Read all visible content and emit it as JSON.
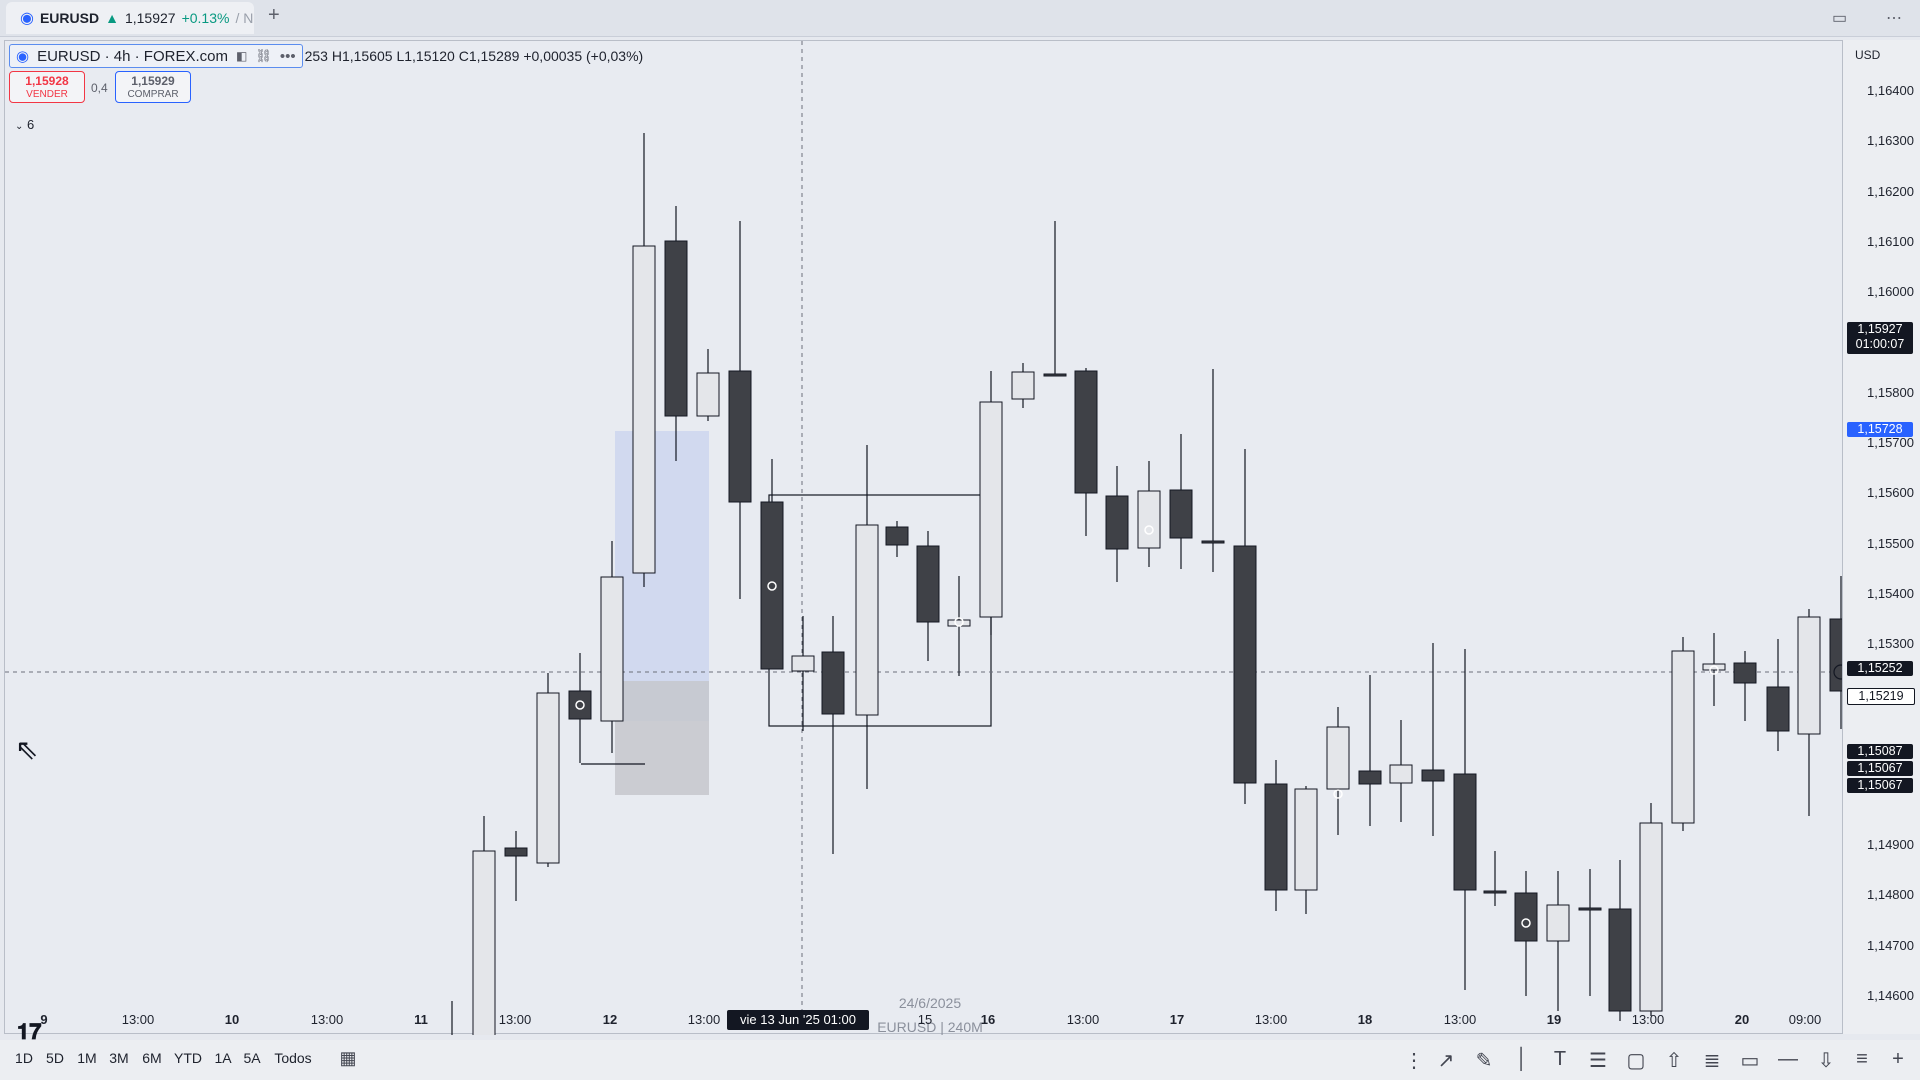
{
  "tab": {
    "symbol": "EURUSD",
    "arrow": "▲",
    "price": "1,15927",
    "change": "+0.13%",
    "suffix": "/ N",
    "add_label": "+"
  },
  "legend": {
    "symbol_label": "EURUSD · 4h · FOREX.com",
    "ohlc": "253 H1,15605 L1,15120 C1,15289 +0,00035 (+0,03%)"
  },
  "trade": {
    "sell_price": "1,15928",
    "sell_label": "VENDER",
    "spread": "0,4",
    "buy_price": "1,15929",
    "buy_label": "COMPRAR"
  },
  "indicators_count": "6",
  "price_scale": {
    "currency": "USD",
    "ticks": [
      "1,16400",
      "1,16300",
      "1,16200",
      "1,16100",
      "1,16000",
      "1,15800",
      "1,15700",
      "1,15600",
      "1,15500",
      "1,15400",
      "1,15300",
      "1,14900",
      "1,14800",
      "1,14700",
      "1,14600"
    ],
    "labels": {
      "last_price": "1,15927",
      "countdown": "01:00:07",
      "blue_level": "1,15728",
      "crosshair_price": "1,15252",
      "level_2": "1,15219",
      "level_3": "1,15087",
      "level_4": "1,15067",
      "level_5": "1,15067"
    }
  },
  "time_axis": {
    "ticks": [
      "9",
      "13:00",
      "10",
      "13:00",
      "11",
      "13:00",
      "12",
      "13:00",
      "15",
      "16",
      "13:00",
      "17",
      "13:00",
      "18",
      "13:00",
      "19",
      "13:00",
      "20",
      "09:00"
    ],
    "crosshair_label": "vie 13 Jun '25   01:00"
  },
  "watermark": {
    "date": "24/6/2025",
    "label": "EURUSD | 240M"
  },
  "ranges": [
    "1D",
    "5D",
    "1M",
    "3M",
    "6M",
    "YTD",
    "1A",
    "5A",
    "Todos"
  ],
  "colors": {
    "bull": "#e4e6ea",
    "bear": "#3f4147",
    "accent_blue": "#2962ff",
    "sell_red": "#f23645",
    "zone_blue": "#c9d3ee",
    "zone_gray": "#c5c7cc"
  },
  "icons": {
    "tab_logo": "chart-logo-icon",
    "layout": "layout-icon",
    "more": "more-icon",
    "tradingview": "tradingview-logo"
  }
}
